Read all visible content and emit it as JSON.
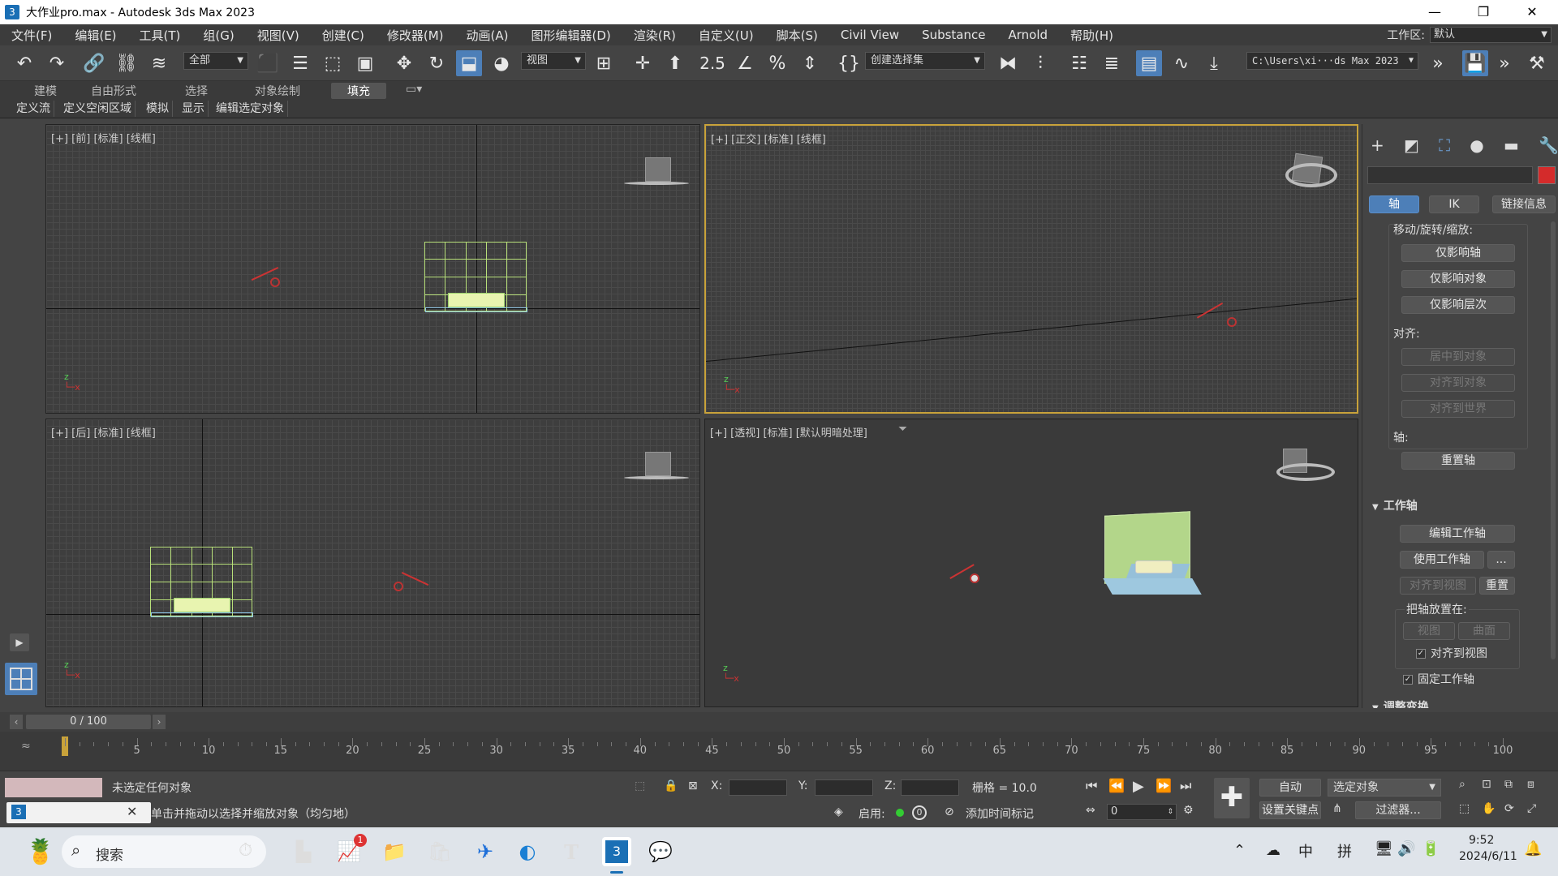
{
  "window": {
    "title": "大作业pro.max - Autodesk 3ds Max 2023",
    "app_icon_label": "3",
    "minimize_icon": "minimize-icon",
    "maximize_icon": "restore-icon",
    "close_icon": "close-icon"
  },
  "menu": {
    "items": [
      "文件(F)",
      "编辑(E)",
      "工具(T)",
      "组(G)",
      "视图(V)",
      "创建(C)",
      "修改器(M)",
      "动画(A)",
      "图形编辑器(D)",
      "渲染(R)",
      "自定义(U)",
      "脚本(S)",
      "Civil View",
      "Substance",
      "Arnold",
      "帮助(H)"
    ],
    "workspace_label": "工作区:",
    "workspace_value": "默认"
  },
  "toolbar": {
    "selection_filter": "全部",
    "ref_coord": "视图",
    "named_selection": "创建选择集",
    "project_path": "C:\\Users\\xi···ds Max 2023",
    "snap_label": "2.5"
  },
  "ribbon": {
    "tabs": [
      "建模",
      "自由形式",
      "选择",
      "对象绘制",
      "填充"
    ],
    "active_tab": "填充",
    "subtabs": [
      "定义流",
      "定义空闲区域",
      "模拟",
      "显示",
      "编辑选定对象"
    ]
  },
  "viewports": {
    "front": "[+] [前] [标准] [线框]",
    "ortho": "[+] [正交] [标准] [线框]",
    "back": "[+] [后] [标准] [线框]",
    "persp": "[+] [透视] [标准] [默认明暗处理]"
  },
  "command_panel": {
    "tabs": [
      "轴",
      "IK",
      "链接信息"
    ],
    "active_tab": "轴",
    "move_rotate_scale_label": "移动/旋转/缩放:",
    "affect_pivot_only": "仅影响轴",
    "affect_object_only": "仅影响对象",
    "affect_hierarchy_only": "仅影响层次",
    "align_label": "对齐:",
    "center_to_object": "居中到对象",
    "align_to_object": "对齐到对象",
    "align_to_world": "对齐到世界",
    "pivot_label": "轴:",
    "reset_pivot": "重置轴",
    "working_pivot_title": "工作轴",
    "edit_working_pivot": "编辑工作轴",
    "use_working_pivot": "使用工作轴",
    "more": "...",
    "align_to_view": "对齐到视图",
    "reset": "重置",
    "place_pivot_label": "把轴放置在:",
    "view": "视图",
    "surface": "曲面",
    "align_to_view_check": "对齐到视图",
    "lock_working_pivot": "固定工作轴",
    "adjust_transform": "调整变换",
    "object_color": "#d42b2b"
  },
  "timeline": {
    "frame_readout": "0 / 100",
    "ticks": [
      "5",
      "10",
      "15",
      "20",
      "25",
      "30",
      "35",
      "40",
      "45",
      "50",
      "55",
      "60",
      "65",
      "70",
      "75",
      "80",
      "85",
      "90",
      "95",
      "100"
    ]
  },
  "status": {
    "selection": "未选定任何对象",
    "prompt": "单击并拖动以选择并缩放对象（均匀地）",
    "x_label": "X:",
    "y_label": "Y:",
    "z_label": "Z:",
    "grid": "栅格 = 10.0",
    "enable_label": "启用:",
    "enable_value": "0",
    "add_time_tag": "添加时间标记",
    "auto_key": "自动",
    "selected_object": "选定对象",
    "set_key": "设置关键点",
    "filters": "过滤器...",
    "frame_value": "0"
  },
  "taskbar": {
    "search": "搜索",
    "time": "9:52",
    "date": "2024/6/11",
    "ime1": "中",
    "ime2": "拼",
    "badge": "1"
  }
}
